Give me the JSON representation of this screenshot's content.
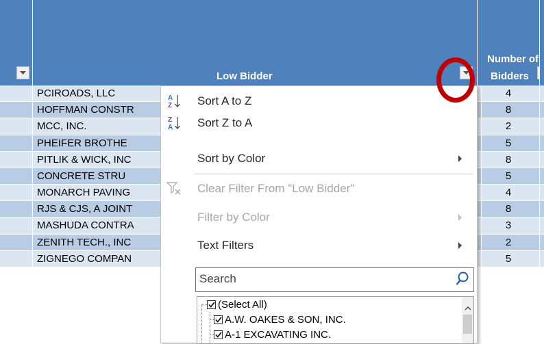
{
  "header": {
    "low_bidder_label": "Low Bidder",
    "number_label_line1": "Number of",
    "number_label_line2": "Bidders"
  },
  "rows": [
    {
      "name": "PCIROADS, LLC",
      "bidders": "4"
    },
    {
      "name": "HOFFMAN CONSTR",
      "bidders": "8"
    },
    {
      "name": "MCC, INC.",
      "bidders": "2"
    },
    {
      "name": "PHEIFER BROTHE",
      "bidders": "5"
    },
    {
      "name": "PITLIK & WICK, INC",
      "bidders": "8"
    },
    {
      "name": "CONCRETE STRU",
      "bidders": "5"
    },
    {
      "name": "MONARCH PAVING",
      "bidders": "4"
    },
    {
      "name": "RJS & CJS, A JOINT",
      "bidders": "8"
    },
    {
      "name": "MASHUDA CONTRA",
      "bidders": "3"
    },
    {
      "name": "ZENITH TECH., INC",
      "bidders": "2"
    },
    {
      "name": "ZIGNEGO COMPAN",
      "bidders": "5"
    }
  ],
  "menu": {
    "sort_az": "Sort A to Z",
    "sort_za": "Sort Z to A",
    "sort_by_color": "Sort by Color",
    "clear_filter": "Clear Filter From \"Low Bidder\"",
    "filter_by_color": "Filter by Color",
    "text_filters": "Text Filters",
    "search_placeholder": "Search",
    "list": [
      "(Select All)",
      "A.W. OAKES & SON, INC.",
      "A-1 EXCAVATING INC."
    ]
  },
  "colors": {
    "header_blue": "#4f81bd",
    "row_light": "#dce6f1",
    "row_dark": "#b8cce4",
    "highlight_circle": "#c00000"
  },
  "icons": {
    "sort_az": "sort-ascending-icon",
    "sort_za": "sort-descending-icon",
    "clear_filter": "clear-filter-icon",
    "search": "magnifier-icon"
  }
}
